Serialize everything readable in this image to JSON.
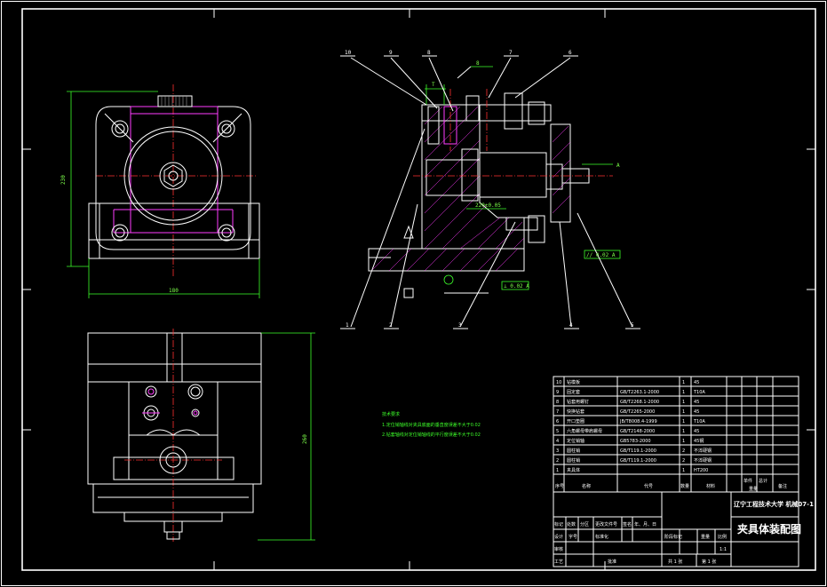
{
  "drawing": {
    "background": "#000000",
    "line_colors": {
      "outline": "#ffffff",
      "section": "#ff3dff",
      "center": "#ff3030",
      "dimension": "#7dff4a"
    }
  },
  "dims": {
    "front_height": "230",
    "front_width": "180",
    "top_height": "260",
    "side_top": "T",
    "side_mid": "8",
    "side_low": "220±0.05",
    "tol_perp": "// 0.02 A",
    "tol_flat": "⊥ 0.02 A",
    "datum": "A"
  },
  "callouts": [
    "10",
    "9",
    "8",
    "7",
    "6",
    "1",
    "2",
    "3",
    "4",
    "5"
  ],
  "notes": {
    "title": "技术要求",
    "lines": [
      "1.定位销轴线对夹具底面的垂直度误差不大于0.02",
      "2.钻套轴线对定位销轴线的平行度误差不大于0.02"
    ]
  },
  "parts_table": {
    "header": [
      "序号",
      "名称",
      "代号",
      "数量",
      "材料",
      "单件",
      "总计",
      "重量",
      "备注"
    ],
    "rows": [
      {
        "no": "10",
        "name": "钻模板",
        "code": "",
        "qty": "1",
        "mat": "45"
      },
      {
        "no": "9",
        "name": "固定套",
        "code": "GB/T2263.1-2000",
        "qty": "1",
        "mat": "T10A"
      },
      {
        "no": "8",
        "name": "钻套用螺钉",
        "code": "GB/T2268.1-2000",
        "qty": "1",
        "mat": "45"
      },
      {
        "no": "7",
        "name": "快换钻套",
        "code": "GB/T2265-2000",
        "qty": "1",
        "mat": "45"
      },
      {
        "no": "6",
        "name": "开口垫圈",
        "code": "JB/T8008.4-1999",
        "qty": "1",
        "mat": "T10A"
      },
      {
        "no": "5",
        "name": "六角螺母带肩螺母",
        "code": "GB/T2148-2000",
        "qty": "1",
        "mat": "45"
      },
      {
        "no": "4",
        "name": "定位销轴",
        "code": "GB5783-2000",
        "qty": "1",
        "mat": "45钢"
      },
      {
        "no": "3",
        "name": "圆柱销",
        "code": "GB/T119.1-2000",
        "qty": "2",
        "mat": "不淬硬钢"
      },
      {
        "no": "2",
        "name": "圆柱销",
        "code": "GB/T119.1-2000",
        "qty": "2",
        "mat": "不淬硬钢"
      },
      {
        "no": "1",
        "name": "夹具体",
        "code": "",
        "qty": "1",
        "mat": "HT200"
      }
    ]
  },
  "title_block": {
    "school": "辽宁工程技术大学 机械07-1",
    "drawing_name": "夹具体装配图",
    "labels": [
      "标记",
      "处数",
      "分区",
      "更改文件号",
      "签名",
      "年、月、日"
    ],
    "row2": [
      "设计",
      "字号",
      "标准化"
    ],
    "row3": [
      "审核"
    ],
    "row4": [
      "工艺",
      "批准"
    ],
    "stage_labels": [
      "阶段标记",
      "重量",
      "比例"
    ],
    "scale": "1:1",
    "sheet_total": "共 1 张",
    "sheet_no": "第 1 张"
  }
}
